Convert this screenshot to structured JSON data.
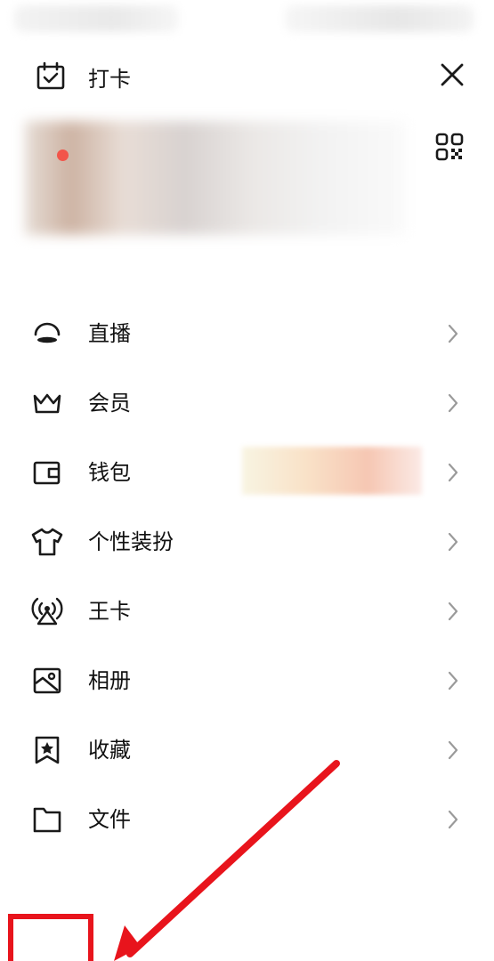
{
  "header": {
    "checkin_label": "打卡",
    "close_icon": "close-icon",
    "qr_icon": "qr-code-icon"
  },
  "menu": {
    "items": [
      {
        "label": "直播",
        "icon": "live-icon"
      },
      {
        "label": "会员",
        "icon": "crown-icon"
      },
      {
        "label": "钱包",
        "icon": "wallet-icon"
      },
      {
        "label": "个性装扮",
        "icon": "tshirt-icon"
      },
      {
        "label": "王卡",
        "icon": "signal-card-icon"
      },
      {
        "label": "相册",
        "icon": "album-icon"
      },
      {
        "label": "收藏",
        "icon": "bookmark-star-icon"
      },
      {
        "label": "文件",
        "icon": "folder-icon"
      }
    ]
  },
  "colors": {
    "text": "#111111",
    "chevron": "#9a9a9a",
    "badge": "#f2554a",
    "annotation": "#e8141c"
  }
}
